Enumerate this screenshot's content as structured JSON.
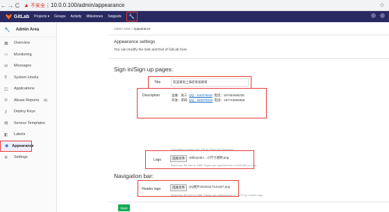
{
  "browser": {
    "back": "←",
    "forward": "→",
    "reload": "C",
    "security": "▲",
    "security_label": "不安全",
    "url": "10.0.0.100/admin/appearance"
  },
  "topnav": {
    "brand": "GitLab",
    "items": [
      "Projects ▾",
      "Groups",
      "Activity",
      "Milestones",
      "Snippets"
    ]
  },
  "sidebar": {
    "title": "Admin Area",
    "items": [
      {
        "label": "Overview",
        "icon": "grid-icon"
      },
      {
        "label": "Monitoring",
        "icon": "monitor-icon"
      },
      {
        "label": "Messages",
        "icon": "message-icon"
      },
      {
        "label": "System Hooks",
        "icon": "hook-icon"
      },
      {
        "label": "Applications",
        "icon": "apps-icon"
      },
      {
        "label": "Abuse Reports",
        "icon": "alert-icon",
        "badge": "0"
      },
      {
        "label": "Deploy Keys",
        "icon": "key-icon"
      },
      {
        "label": "Service Templates",
        "icon": "template-icon"
      },
      {
        "label": "Labels",
        "icon": "label-icon"
      },
      {
        "label": "Appearance",
        "icon": "appearance-icon",
        "active": true
      },
      {
        "label": "Settings",
        "icon": "gear-icon"
      }
    ]
  },
  "breadcrumb": {
    "parent": "Admin Area",
    "sep": ">",
    "current": "Appearance"
  },
  "main": {
    "heading": "Appearance settings",
    "description": "You can modify the look and feel of GitLab here",
    "signin_heading": "Sign in/Sign up pages:",
    "title_label": "Title",
    "title_value": "欢迎来到上海老男孩教育",
    "description_label": "Description",
    "desc_line1_prefix": "运维：张三",
    "desc_line1_qq": "QQ：118375532",
    "desc_line1_phone": "电话：187454595235",
    "desc_line2_prefix": "开发：李四",
    "desc_line2_qq": "QQ：548375915",
    "desc_line2_phone": "电话：187743584959",
    "desc_help": "Description parsed with GitLab Flavored Markdown",
    "logo_label": "Logo",
    "logo_button": "选择文件",
    "logo_file": "oldboyedu-...小尺寸透明.png",
    "logo_help": "Maximum file size is 1MB. Pages are optimized for a 640x360 px logo.",
    "nav_heading": "Navigation bar:",
    "header_logo_label": "Header logo",
    "header_logo_button": "选择文件",
    "header_logo_file": "QQ图片20191117144157.png",
    "header_logo_help": "Maximum file size is 1MB. Pages are optimized for a 72x72 px header logo",
    "save_label": "Save"
  },
  "colors": {
    "nav": "#292961",
    "accent": "#e53935",
    "save": "#1aaa55",
    "link": "#1068bf"
  }
}
